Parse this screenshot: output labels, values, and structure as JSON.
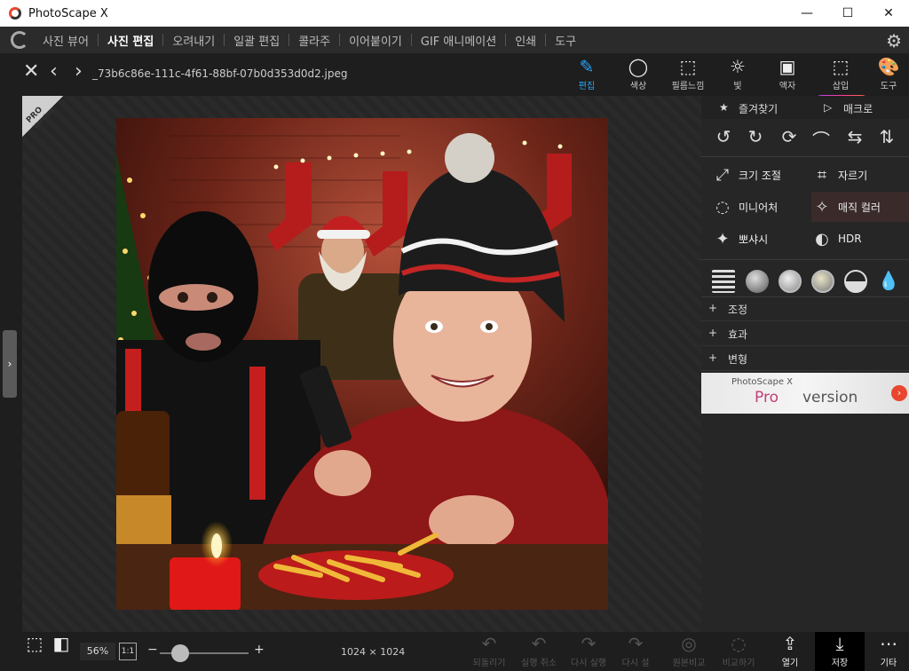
{
  "app": {
    "title": "PhotoScape X"
  },
  "window": {
    "minimize": "—",
    "maximize": "☐",
    "close": "✕"
  },
  "menu": {
    "items": [
      "사진 뷰어",
      "사진 편집",
      "오려내기",
      "일괄 편집",
      "콜라주",
      "이어붙이기",
      "GIF 애니메이션",
      "인쇄",
      "도구"
    ],
    "active": "사진 편집"
  },
  "toolbar": {
    "filename": "_73b6c86e-111c-4f61-88bf-07b0d353d0d2.jpeg",
    "tools": [
      {
        "label": "편집",
        "icon": "edit-icon"
      },
      {
        "label": "색상",
        "icon": "color-icon"
      },
      {
        "label": "필름느낌",
        "icon": "film-icon"
      },
      {
        "label": "빛",
        "icon": "light-icon"
      },
      {
        "label": "액자",
        "icon": "frame-icon"
      },
      {
        "label": "삽입",
        "icon": "insert-icon"
      },
      {
        "label": "도구",
        "icon": "tools-icon"
      }
    ],
    "active": "편집"
  },
  "badge": {
    "pro": "PRO",
    "version": "Version"
  },
  "panel": {
    "favorites": "즐겨찾기",
    "macro": "매크로",
    "features": [
      "크기 조절",
      "자르기",
      "미니어처",
      "매직 컬러",
      "뽀샤시",
      "HDR"
    ],
    "accordions": [
      "조정",
      "효과",
      "변형"
    ],
    "promo": {
      "small": "PhotoScape X",
      "pro": "Pro",
      "version": "version"
    }
  },
  "bottom": {
    "zoom": "56%",
    "one_to_one": "1:1",
    "minus": "−",
    "plus": "+",
    "dimensions": "1024 × 1024",
    "zoom_level": 0.56,
    "actions": [
      "되돌리기",
      "실행 취소",
      "다시 실행",
      "다시 설",
      "원본비교",
      "비교하기",
      "열기",
      "저장",
      "기타"
    ]
  },
  "colors": {
    "accent": "#29a3f5",
    "brand": "#e8462f",
    "promo_pink": "#c0407a"
  }
}
